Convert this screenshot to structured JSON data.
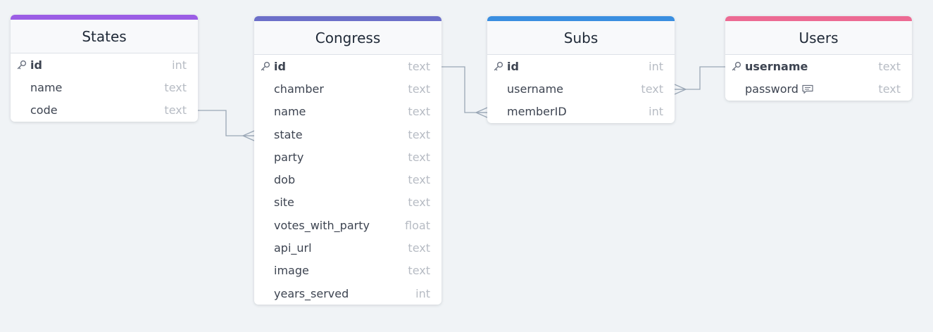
{
  "tables": [
    {
      "name": "States",
      "accent": "#9b5de5",
      "fields": [
        {
          "name": "id",
          "type": "int",
          "pk": true
        },
        {
          "name": "name",
          "type": "text"
        },
        {
          "name": "code",
          "type": "text"
        }
      ]
    },
    {
      "name": "Congress",
      "accent": "#6c6fc9",
      "fields": [
        {
          "name": "id",
          "type": "text",
          "pk": true
        },
        {
          "name": "chamber",
          "type": "text"
        },
        {
          "name": "name",
          "type": "text"
        },
        {
          "name": "state",
          "type": "text"
        },
        {
          "name": "party",
          "type": "text"
        },
        {
          "name": "dob",
          "type": "text"
        },
        {
          "name": "site",
          "type": "text"
        },
        {
          "name": "votes_with_party",
          "type": "float"
        },
        {
          "name": "api_url",
          "type": "text"
        },
        {
          "name": "image",
          "type": "text"
        },
        {
          "name": "years_served",
          "type": "int"
        }
      ]
    },
    {
      "name": "Subs",
      "accent": "#3a8ee0",
      "fields": [
        {
          "name": "id",
          "type": "int",
          "pk": true
        },
        {
          "name": "username",
          "type": "text"
        },
        {
          "name": "memberID",
          "type": "int"
        }
      ]
    },
    {
      "name": "Users",
      "accent": "#ec6a93",
      "fields": [
        {
          "name": "username",
          "type": "text",
          "pk": true
        },
        {
          "name": "password",
          "type": "text",
          "note": true
        }
      ]
    }
  ],
  "relations": [
    {
      "from": "States.code",
      "to": "Congress.state",
      "cardinality": "one-to-many"
    },
    {
      "from": "Congress.id",
      "to": "Subs.memberID",
      "cardinality": "one-to-many"
    },
    {
      "from": "Users.username",
      "to": "Subs.username",
      "cardinality": "one-to-many"
    }
  ],
  "connector_color": "#9aa7b6"
}
